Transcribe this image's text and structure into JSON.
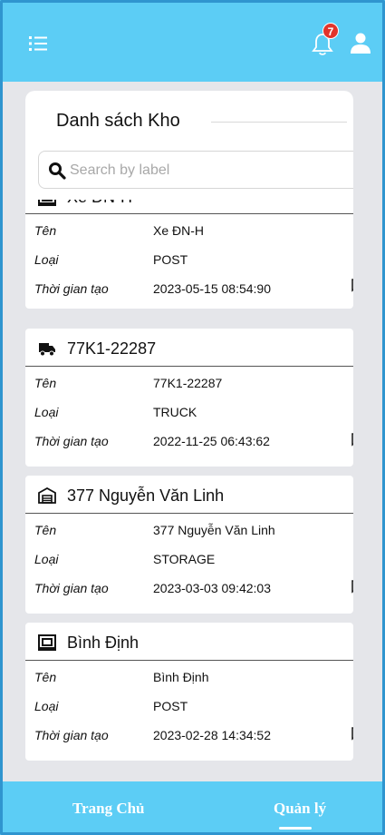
{
  "topbar": {
    "menu_icon": "list-menu-icon",
    "bell_icon": "bell-icon",
    "notification_count": "7",
    "user_icon": "user-icon",
    "accent": "#5ccdf5",
    "badge_color": "#e2342b"
  },
  "panel": {
    "title": "Danh sách Kho",
    "search_placeholder": "Search by label",
    "search_icon": "search-icon"
  },
  "warehouses": [
    {
      "icon": "post-icon",
      "name": "Xe ĐN-H",
      "fields": [
        {
          "label": "Tên",
          "value": "Xe ĐN-H"
        },
        {
          "label": "Loại",
          "value": "POST"
        },
        {
          "label": "Thời gian tạo",
          "value": "2023-05-15 08:54:90"
        }
      ]
    },
    {
      "icon": "truck-icon",
      "name": "77K1-22287",
      "fields": [
        {
          "label": "Tên",
          "value": "77K1-22287"
        },
        {
          "label": "Loại",
          "value": "TRUCK"
        },
        {
          "label": "Thời gian tạo",
          "value": "2022-11-25 06:43:62"
        }
      ]
    },
    {
      "icon": "storage-icon",
      "name": "377 Nguyễn Văn Linh",
      "fields": [
        {
          "label": "Tên",
          "value": "377 Nguyễn Văn Linh"
        },
        {
          "label": "Loại",
          "value": "STORAGE"
        },
        {
          "label": "Thời gian tạo",
          "value": "2023-03-03 09:42:03"
        }
      ]
    },
    {
      "icon": "post-icon",
      "name": "Bình Định",
      "fields": [
        {
          "label": "Tên",
          "value": "Bình Định"
        },
        {
          "label": "Loại",
          "value": "POST"
        },
        {
          "label": "Thời gian tạo",
          "value": "2023-02-28 14:34:52"
        }
      ]
    }
  ],
  "bottom_nav": {
    "home_label": "Trang Chủ",
    "manage_label": "Quản lý",
    "active": "Quản lý"
  }
}
